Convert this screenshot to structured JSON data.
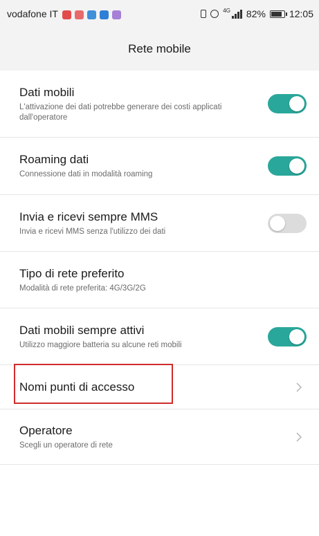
{
  "statusbar": {
    "carrier": "vodafone IT",
    "notifications": [
      {
        "name": "notification-icon-1",
        "color": "#e34b4b"
      },
      {
        "name": "notification-icon-2",
        "color": "#e86a6a"
      },
      {
        "name": "notification-icon-3",
        "color": "#3f8fd9"
      },
      {
        "name": "notification-icon-4",
        "color": "#2e7fd6"
      },
      {
        "name": "notification-icon-5",
        "color": "#a67fd6"
      }
    ],
    "network_type": "4G",
    "battery": "82%",
    "battery_level": 0.82,
    "time": "12:05"
  },
  "header": {
    "title": "Rete mobile"
  },
  "colors": {
    "toggle_on": "#2aa79b",
    "toggle_off": "#dcdcdc",
    "highlight": "#cf2b2b"
  },
  "settings": [
    {
      "title": "Dati mobili",
      "subtitle": "L'attivazione dei dati potrebbe generare dei costi applicati dall'operatore",
      "control": "toggle",
      "state": "on"
    },
    {
      "title": "Roaming dati",
      "subtitle": "Connessione dati in modalità roaming",
      "control": "toggle",
      "state": "on"
    },
    {
      "title": "Invia e ricevi sempre MMS",
      "subtitle": "Invia e ricevi MMS senza l'utilizzo dei dati",
      "control": "toggle",
      "state": "off"
    },
    {
      "title": "Tipo di rete preferito",
      "subtitle": "Modalità di rete preferita: 4G/3G/2G",
      "control": "none"
    },
    {
      "title": "Dati mobili sempre attivi",
      "subtitle": "Utilizzo maggiore batteria su alcune reti mobili",
      "control": "toggle",
      "state": "on"
    },
    {
      "title": "Nomi punti di accesso",
      "subtitle": "",
      "control": "chevron",
      "highlighted": true
    },
    {
      "title": "Operatore",
      "subtitle": "Scegli un operatore di rete",
      "control": "chevron"
    }
  ]
}
